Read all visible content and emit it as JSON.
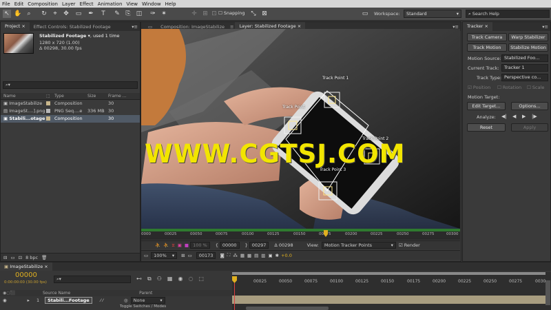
{
  "menu": [
    "File",
    "Edit",
    "Composition",
    "Layer",
    "Effect",
    "Animation",
    "View",
    "Window",
    "Help"
  ],
  "toolbar": {
    "snapping_label": "Snapping",
    "workspace_label": "Workspace:",
    "workspace_value": "Standard",
    "search_placeholder": "Search Help"
  },
  "project": {
    "tab_project": "Project",
    "tab_effect_controls": "Effect Controls: Stabilized Footage",
    "item_title": "Stabilized Footage",
    "item_used": ", used 1 time",
    "item_dims": "1280 x 720 (1.00)",
    "item_duration": "Δ 00298, 30.00 fps",
    "search_value": "",
    "columns": {
      "name": "Name",
      "type": "Type",
      "size": "Size",
      "frame": "Frame ..."
    },
    "rows": [
      {
        "name": "ImageStabilize",
        "type": "Composition",
        "size": "",
        "frame": "30",
        "color": "#c9b78c"
      },
      {
        "name": "ImageSt....].png",
        "type": "PNG Seq....e",
        "size": "336 MB",
        "frame": "30",
        "color": "#b7b7b7"
      },
      {
        "name": "Stabili...otage",
        "type": "Composition",
        "size": "",
        "frame": "30",
        "color": "#c9b78c"
      }
    ],
    "bpc": "8 bpc"
  },
  "viewer": {
    "tab_composition": "Composition: ImageStabilize",
    "tab_layer": "Layer: Stabilized Footage",
    "watermark": "WWW.CGTSJ.COM",
    "track_points": [
      "Track Point 1",
      "Track Point",
      "Track Point 2",
      "Track Point 3"
    ]
  },
  "layer_controls": {
    "ruler_ticks": [
      "0000",
      "00025",
      "00050",
      "00075",
      "00100",
      "00125",
      "00150",
      "00175",
      "00200",
      "00225",
      "00250",
      "00275",
      "00300"
    ],
    "zoom_percent": "100 %",
    "in_time": "00000",
    "out_time": "00297",
    "duration": "Δ 00298",
    "view_label": "View:",
    "view_value": "Motion Tracker Points",
    "render_label": "Render",
    "magnification": "100%",
    "current_frame": "00173",
    "exposure": "+0.0"
  },
  "tracker": {
    "title": "Tracker",
    "track_camera": "Track Camera",
    "warp_stabilizer": "Warp Stabilizer",
    "track_motion": "Track Motion",
    "stabilize_motion": "Stabilize Motion",
    "motion_source_label": "Motion Source:",
    "motion_source_value": "Stabilized Foo...",
    "current_track_label": "Current Track:",
    "current_track_value": "Tracker 1",
    "track_type_label": "Track Type:",
    "track_type_value": "Perspective co...",
    "position": "Position",
    "rotation": "Rotation",
    "scale": "Scale",
    "motion_target_label": "Motion Target:",
    "edit_target": "Edit Target...",
    "options": "Options...",
    "analyze_label": "Analyze:",
    "reset": "Reset",
    "apply": "Apply"
  },
  "timeline": {
    "tab": "ImageStabilize",
    "timecode": "00000",
    "timecode_sub": "0:00:00:00 (30.00 fps)",
    "columns": {
      "source_name": "Source Name",
      "parent": "Parent"
    },
    "layer_number": "1",
    "layer_name": "Stabili...Footage",
    "parent_value": "None",
    "toggle_label": "Toggle Switches / Modes",
    "ticks": [
      "00025",
      "00050",
      "00075",
      "00100",
      "00125",
      "00150",
      "00175",
      "00200",
      "00225",
      "00250",
      "00275",
      "0030"
    ]
  }
}
